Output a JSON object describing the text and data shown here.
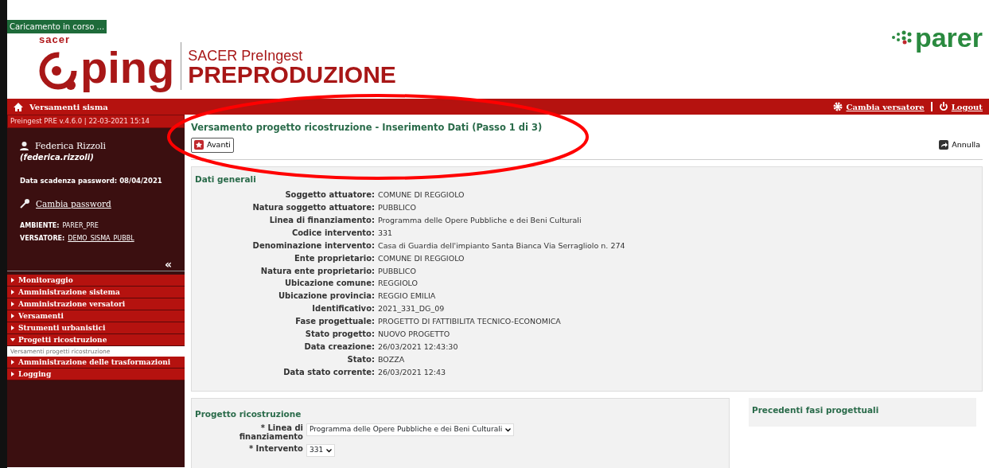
{
  "loading": "Caricamento in corso ...",
  "logo": {
    "brand_small": "sacer",
    "brand": "ping",
    "subtitle": "SACER PreIngest",
    "title": "PREPRODUZIONE"
  },
  "partner_logo": {
    "text": "parer"
  },
  "topbar": {
    "home": "Versamenti sisma",
    "links": [
      {
        "label": "Cambia versatore",
        "kind": "gear"
      },
      {
        "label": "Logout",
        "kind": "power"
      }
    ]
  },
  "sidebar": {
    "version": "Preingest PRE v.4.6.0 | 22-03-2021 15:14",
    "user_name": "Federica Rizzoli",
    "user_id": "(federica.rizzoli)",
    "password_expiry": "Data scadenza password: 08/04/2021",
    "change_password": "Cambia password",
    "environment_label": "AMBIENTE:",
    "environment": "PARER_PRE",
    "depositor_label": "VERSATORE:",
    "depositor": "DEMO_SISMA_PUBBL",
    "collapse": "«",
    "menu": [
      {
        "label": "Monitoraggio",
        "expanded": false
      },
      {
        "label": "Amministrazione sistema",
        "expanded": false
      },
      {
        "label": "Amministrazione versatori",
        "expanded": false
      },
      {
        "label": "Versamenti",
        "expanded": false
      },
      {
        "label": "Strumenti urbanistici",
        "expanded": false
      },
      {
        "label": "Progetti ricostruzione",
        "expanded": true,
        "children": [
          {
            "label": "Versamenti progetti ricostruzione",
            "selected": true
          }
        ]
      },
      {
        "label": "Amministrazione delle trasformazioni",
        "expanded": false
      },
      {
        "label": "Logging",
        "expanded": false
      }
    ]
  },
  "page_title": "Versamento progetto ricostruzione - Inserimento Dati (Passo 1 di 3)",
  "actions": [
    {
      "label": "Avanti",
      "kind": "next"
    },
    {
      "label": "Annulla",
      "kind": "cancel"
    }
  ],
  "general": {
    "title": "Dati generali",
    "fields": [
      {
        "label": "Soggetto attuatore:",
        "value": "COMUNE DI REGGIOLO"
      },
      {
        "label": "Natura soggetto attuatore:",
        "value": "PUBBLICO"
      },
      {
        "label": "Linea di finanziamento:",
        "value": "Programma delle Opere Pubbliche e dei Beni Culturali"
      },
      {
        "label": "Codice intervento:",
        "value": "331"
      },
      {
        "label": "Denominazione intervento:",
        "value": "Casa di Guardia dell'impianto Santa Bianca Via Serragliolo n. 274"
      },
      {
        "label": "Ente proprietario:",
        "value": "COMUNE DI REGGIOLO"
      },
      {
        "label": "Natura ente proprietario:",
        "value": "PUBBLICO"
      },
      {
        "label": "Ubicazione comune:",
        "value": "REGGIOLO"
      },
      {
        "label": "Ubicazione provincia:",
        "value": "REGGIO EMILIA"
      },
      {
        "label": "Identificativo:",
        "value": "2021_331_DG_09"
      },
      {
        "label": "Fase progettuale:",
        "value": "PROGETTO DI FATTIBILITA TECNICO-ECONOMICA"
      },
      {
        "label": "Stato progetto:",
        "value": "NUOVO PROGETTO"
      },
      {
        "label": "Data creazione:",
        "value": "26/03/2021 12:43:30"
      },
      {
        "label": "Stato:",
        "value": "BOZZA"
      },
      {
        "label": "Data stato corrente:",
        "value": "26/03/2021 12:43"
      }
    ]
  },
  "project": {
    "title": "Progetto ricostruzione",
    "fields": [
      {
        "label": "* Linea di finanziamento",
        "value": "Programma delle Opere Pubbliche e dei Beni Culturali"
      },
      {
        "label": "* Intervento",
        "value": "331"
      }
    ]
  },
  "previous_phases": {
    "title": "Precedenti fasi progettuali"
  }
}
